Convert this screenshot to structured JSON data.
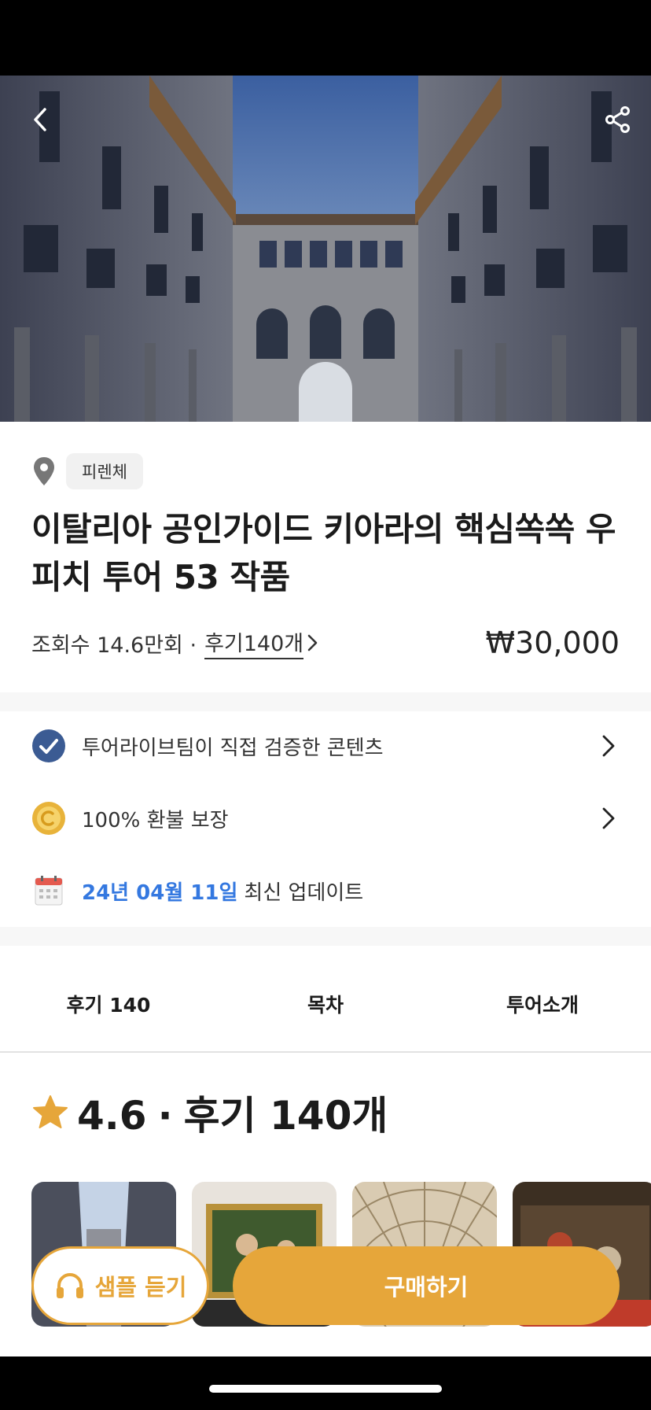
{
  "hero": {
    "alt": "Uffizi courtyard photo"
  },
  "header": {
    "back_icon": "chevron-left-icon",
    "share_icon": "share-icon"
  },
  "location": {
    "icon": "map-pin-icon",
    "label": "피렌체"
  },
  "title": "이탈리아 공인가이드 키아라의 핵심쏙쏙 우피치 투어 53 작품",
  "meta": {
    "views": "조회수 14.6만회 ·",
    "reviews_link": "후기140개",
    "price": "₩30,000"
  },
  "features": {
    "verified": {
      "icon": "check-badge-icon",
      "label": "투어라이브팀이 직접 검증한 콘텐츠"
    },
    "refund": {
      "icon": "coin-icon",
      "label": "100% 환불 보장"
    },
    "updated": {
      "icon": "calendar-icon",
      "date": "24년 04월 11일",
      "suffix": "최신 업데이트"
    }
  },
  "tabs": [
    "후기 140",
    "목차",
    "투어소개"
  ],
  "rating": {
    "score": "4.6",
    "separator": "·",
    "count": "후기 140개"
  },
  "bottom": {
    "sample_label": "샘플 듣기",
    "buy_label": "구매하기"
  },
  "colors": {
    "accent": "#e6a63a",
    "link_blue": "#3478e0",
    "check_badge": "#3b5b93"
  }
}
